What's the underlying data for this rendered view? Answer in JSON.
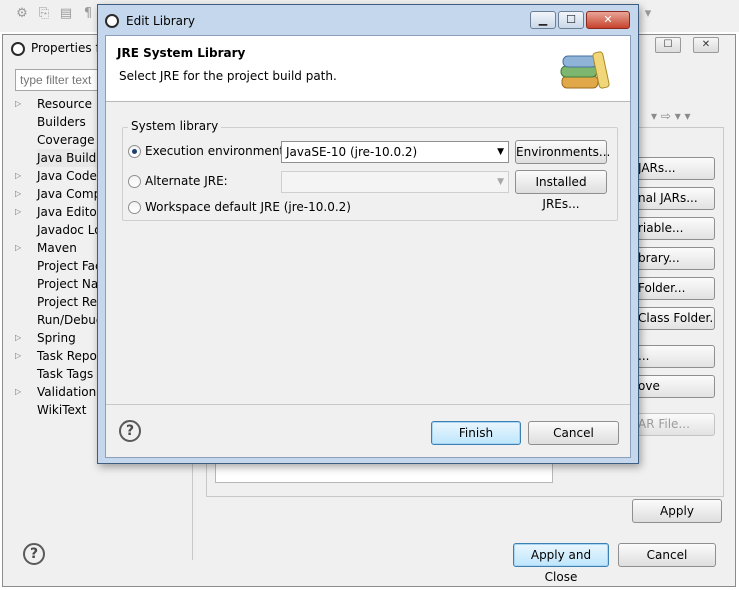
{
  "background": {
    "title": "Properties fo",
    "filter_placeholder": "type filter text",
    "tree": [
      {
        "label": "Resource",
        "expandable": true
      },
      {
        "label": "Builders",
        "expandable": false
      },
      {
        "label": "Coverage",
        "expandable": false
      },
      {
        "label": "Java Build P",
        "expandable": false,
        "selected": true
      },
      {
        "label": "Java Code S",
        "expandable": true
      },
      {
        "label": "Java Compi",
        "expandable": true
      },
      {
        "label": "Java Editor",
        "expandable": true
      },
      {
        "label": "Javadoc Loc",
        "expandable": false
      },
      {
        "label": "Maven",
        "expandable": true
      },
      {
        "label": "Project Face",
        "expandable": false
      },
      {
        "label": "Project Nat",
        "expandable": false
      },
      {
        "label": "Project Refe",
        "expandable": false
      },
      {
        "label": "Run/Debug",
        "expandable": false
      },
      {
        "label": "Spring",
        "expandable": true
      },
      {
        "label": "Task Reposi",
        "expandable": true
      },
      {
        "label": "Task Tags",
        "expandable": false
      },
      {
        "label": "Validation",
        "expandable": true
      },
      {
        "label": "WikiText",
        "expandable": false
      }
    ],
    "side_buttons": [
      {
        "label": "JARs...",
        "disabled": false
      },
      {
        "label": "nal JARs...",
        "disabled": false
      },
      {
        "label": "riable...",
        "disabled": false
      },
      {
        "label": "brary...",
        "disabled": false
      },
      {
        "label": "Folder...",
        "disabled": false
      },
      {
        "label": "Class Folder...",
        "disabled": false
      },
      {
        "label": "...",
        "disabled": false
      },
      {
        "label": "ove",
        "disabled": false
      },
      {
        "label": "AR File...",
        "disabled": true
      }
    ],
    "apply_label": "Apply",
    "apply_close_label": "Apply and Close",
    "cancel_label": "Cancel",
    "nav_arrows": "▾  ⇨ ▾  ▾"
  },
  "dialog": {
    "title": "Edit Library",
    "header_title": "JRE System Library",
    "header_desc": "Select JRE for the project build path.",
    "group_label": "System library",
    "options": {
      "execution_env": {
        "label": "Execution environment:",
        "checked": true,
        "value": "JavaSE-10 (jre-10.0.2)",
        "button": "Environments..."
      },
      "alternate_jre": {
        "label": "Alternate JRE:",
        "checked": false,
        "value": "",
        "button": "Installed JREs..."
      },
      "workspace_default": {
        "label": "Workspace default JRE (jre-10.0.2)",
        "checked": false
      }
    },
    "finish_label": "Finish",
    "cancel_label": "Cancel",
    "window_controls": {
      "minimize": "▁",
      "maximize": "☐",
      "close": "✕"
    }
  },
  "colors": {
    "accent": "#3c7fb1",
    "dialog_frame": "#c5d7ec"
  }
}
